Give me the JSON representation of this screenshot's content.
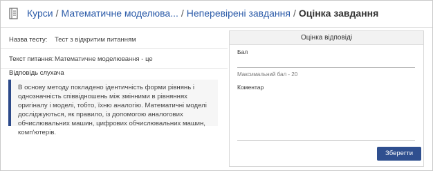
{
  "breadcrumb": {
    "courses": "Курси",
    "course": "Математичне моделюва...",
    "unchecked": "Неперевірені завдання",
    "current": "Оцінка завдання",
    "separator": "/"
  },
  "test_info": {
    "test_name_label": "Назва тесту:",
    "test_name_value": "Тест з відкритим питанням",
    "question_text_label": "Текст питання:",
    "question_text_value": "Математичне моделювання - це"
  },
  "student_answer": {
    "label": "Відповідь слухача",
    "text": "В основу методу покладено ідентичність форми рівнянь і однозначність співвідношень між змінними в рівняннях оригіналу і моделі, тобто, їхню аналогію. Математичні моделі досліджуються, як правило, із допомогою аналогових обчислювальних машин, цифрових обчислювальних машин, комп'ютерів."
  },
  "grading_panel": {
    "title": "Оцінка відповіді",
    "score_label": "Бал",
    "score_value": "",
    "max_score_hint": "Максимальний бал - 20",
    "comment_label": "Коментар",
    "comment_value": "",
    "save_label": "Зберегти"
  },
  "colors": {
    "link": "#2a5aa8",
    "accent": "#2f4f8f"
  },
  "icons": {
    "header": "book-icon"
  }
}
